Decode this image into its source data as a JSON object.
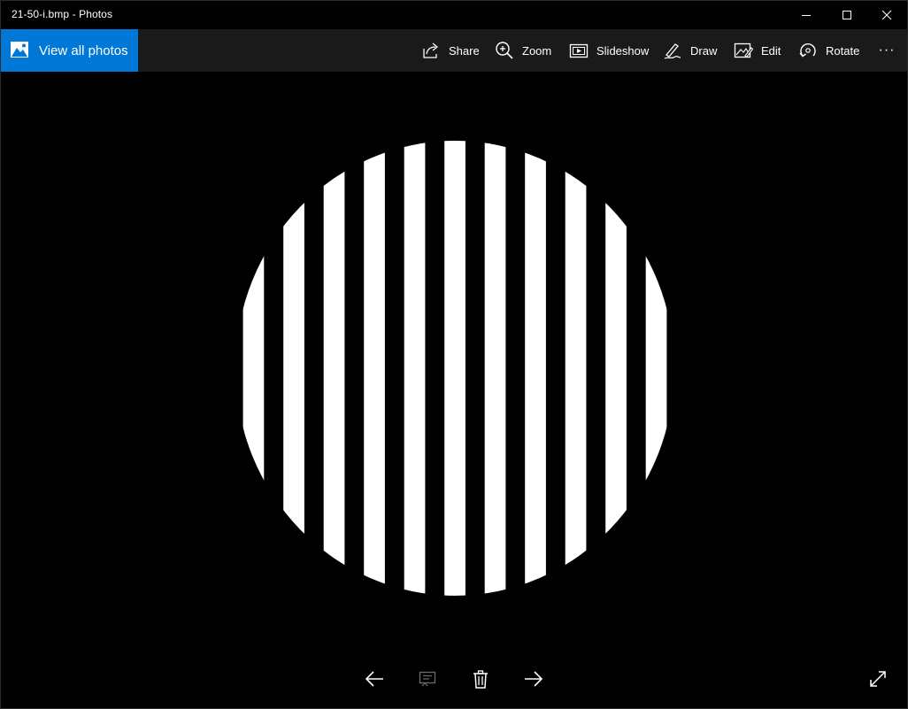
{
  "window": {
    "title": "21-50-i.bmp - Photos"
  },
  "controls": {
    "minimize_icon": "minimize-icon",
    "maximize_icon": "maximize-icon",
    "close_icon": "close-icon"
  },
  "toolbar": {
    "view_all": {
      "label": "View all photos",
      "icon": "photos-icon",
      "color": "#0078d7"
    },
    "items": [
      {
        "label": "Share",
        "icon": "share-icon"
      },
      {
        "label": "Zoom",
        "icon": "zoom-icon"
      },
      {
        "label": "Slideshow",
        "icon": "slideshow-icon"
      },
      {
        "label": "Draw",
        "icon": "draw-icon"
      },
      {
        "label": "Edit",
        "icon": "edit-icon"
      },
      {
        "label": "Rotate",
        "icon": "rotate-icon"
      }
    ],
    "more_label": "···"
  },
  "photo": {
    "description_icon": "striped-circle-image",
    "stripe_count": 11,
    "fg": "#ffffff",
    "bg": "#000000"
  },
  "bottom": {
    "previous_icon": "arrow-left-icon",
    "open_with_icon": "open-with-icon",
    "delete_icon": "trash-icon",
    "next_icon": "arrow-right-icon",
    "fullscreen_icon": "fullscreen-icon"
  }
}
